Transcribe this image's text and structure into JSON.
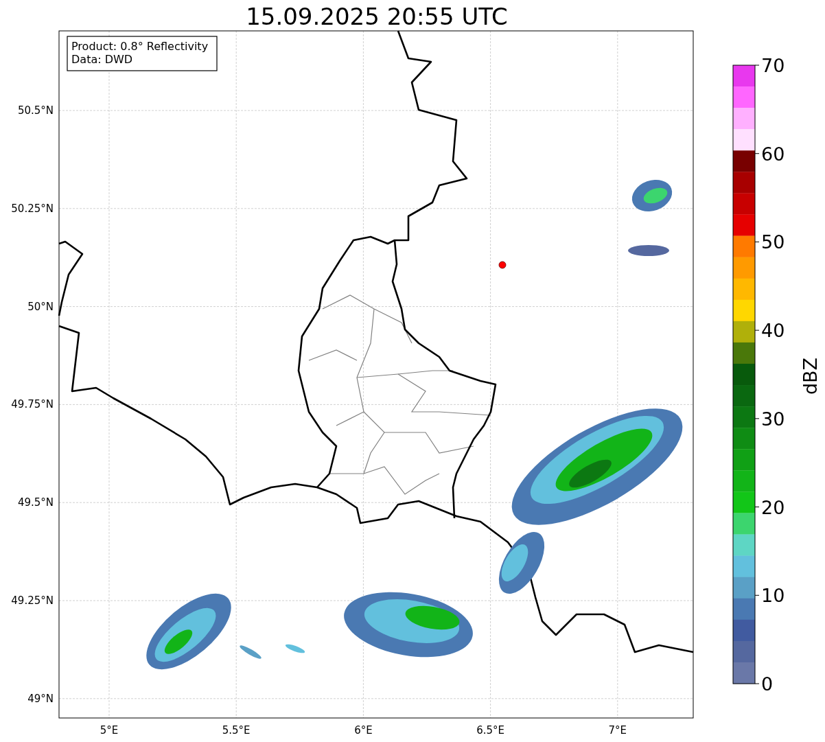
{
  "title": "15.09.2025 20:55 UTC",
  "info_box": [
    "Product: 0.8° Reflectivity",
    "Data: DWD"
  ],
  "map": {
    "xticks": [
      "5°E",
      "5.5°E",
      "6°E",
      "6.5°E",
      "7°E"
    ],
    "yticks": [
      "50.5°N",
      "50.25°N",
      "50°N",
      "49.75°N",
      "49.5°N",
      "49.25°N",
      "49°N"
    ]
  },
  "colorbar": {
    "label": "dBZ",
    "ticks": [
      "70",
      "60",
      "50",
      "40",
      "30",
      "20",
      "10",
      "0"
    ],
    "segments": [
      {
        "color": "#e838ee"
      },
      {
        "color": "#ff66ff"
      },
      {
        "color": "#ffb0ff"
      },
      {
        "color": "#ffe0ff"
      },
      {
        "color": "#780000"
      },
      {
        "color": "#a80000"
      },
      {
        "color": "#c80000"
      },
      {
        "color": "#e60000"
      },
      {
        "color": "#ff7a00"
      },
      {
        "color": "#ff9a00"
      },
      {
        "color": "#ffb800"
      },
      {
        "color": "#ffd700"
      },
      {
        "color": "#b0b00a"
      },
      {
        "color": "#4a780a"
      },
      {
        "color": "#085a0c"
      },
      {
        "color": "#0a6810"
      },
      {
        "color": "#0c7812"
      },
      {
        "color": "#0f8c14"
      },
      {
        "color": "#10a015"
      },
      {
        "color": "#12b418"
      },
      {
        "color": "#12c618"
      },
      {
        "color": "#3cd56e"
      },
      {
        "color": "#5ed6c4"
      },
      {
        "color": "#62c0dd"
      },
      {
        "color": "#5aa0c6"
      },
      {
        "color": "#4a79b2"
      },
      {
        "color": "#415ba0"
      },
      {
        "color": "#55689f"
      },
      {
        "color": "#6a78a8"
      }
    ]
  }
}
